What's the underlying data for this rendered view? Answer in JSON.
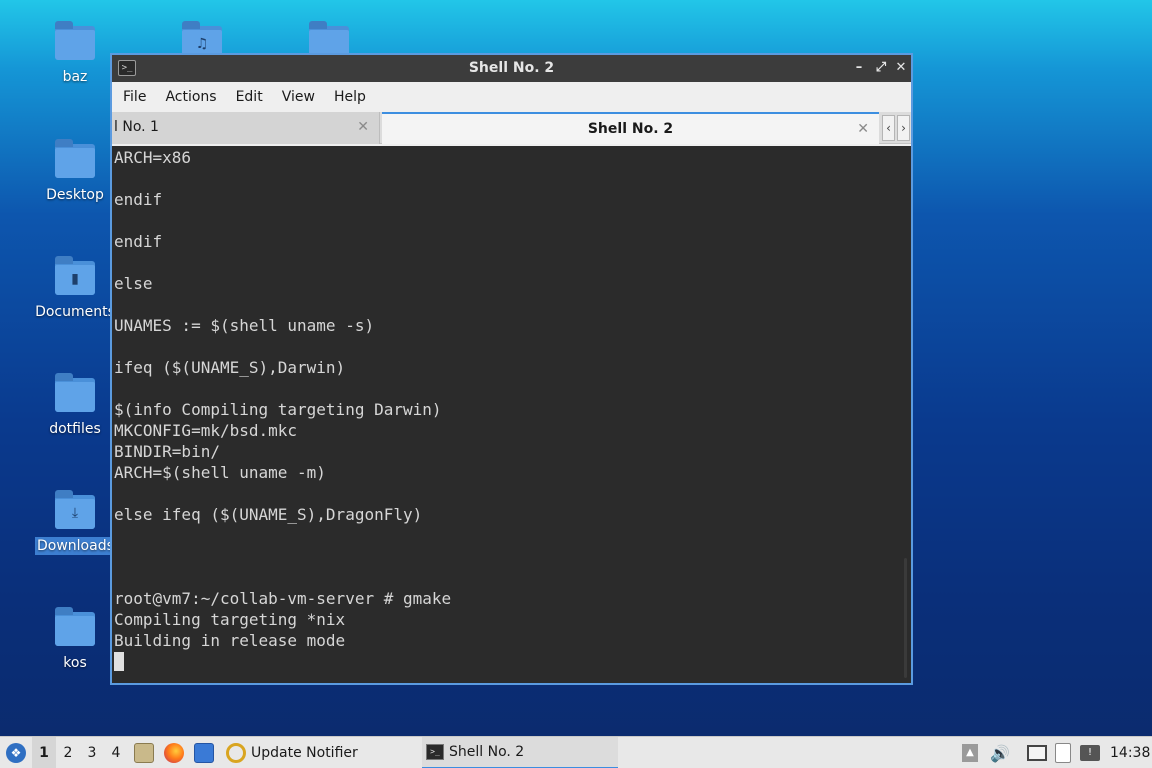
{
  "desktop": {
    "icons": [
      {
        "label": "baz"
      },
      {
        "label": "Desktop"
      },
      {
        "label": "Documents"
      },
      {
        "label": "dotfiles"
      },
      {
        "label": "Downloads"
      },
      {
        "label": "kos"
      }
    ]
  },
  "window": {
    "title": "Shell No. 2",
    "menu": [
      "File",
      "Actions",
      "Edit",
      "View",
      "Help"
    ],
    "tabs": [
      {
        "label": "l No. 1"
      },
      {
        "label": "Shell No. 2"
      }
    ],
    "terminal_lines": [
      "ARCH=x86",
      "",
      "endif",
      "",
      "endif",
      "",
      "else",
      "",
      "UNAMES := $(shell uname -s)",
      "",
      "ifeq ($(UNAME_S),Darwin)",
      "",
      "$(info Compiling targeting Darwin)",
      "MKCONFIG=mk/bsd.mkc",
      "BINDIR=bin/",
      "ARCH=$(shell uname -m)",
      "",
      "else ifeq ($(UNAME_S),DragonFly)",
      "",
      "",
      "",
      "root@vm7:~/collab-vm-server # gmake",
      "Compiling targeting *nix",
      "Building in release mode"
    ]
  },
  "taskbar": {
    "workspaces": [
      "1",
      "2",
      "3",
      "4"
    ],
    "tasks": [
      {
        "label": "Update Notifier"
      },
      {
        "label": "Shell No. 2"
      }
    ],
    "clock": "14:38"
  }
}
